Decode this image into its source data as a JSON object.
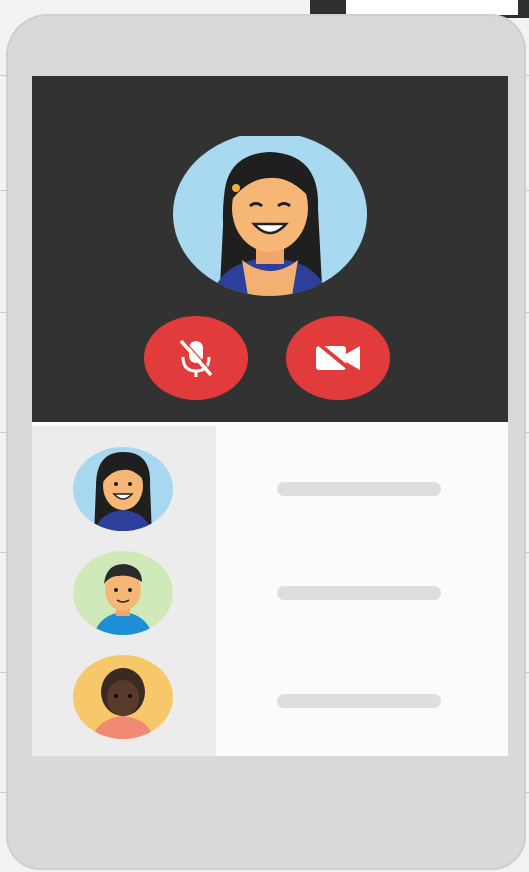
{
  "device": {
    "type": "smartphone"
  },
  "call": {
    "main_participant": {
      "avatar": "woman-avatar-icon"
    },
    "controls": [
      {
        "name": "mute-microphone-button",
        "icon": "mic-off-icon",
        "color": "#e23b3b"
      },
      {
        "name": "stop-video-button",
        "icon": "video-off-icon",
        "color": "#e23b3b"
      }
    ]
  },
  "participants": [
    {
      "avatar": "woman-avatar-icon",
      "avatar_bg": "#a8d8ef"
    },
    {
      "avatar": "man-avatar-icon",
      "avatar_bg": "#cfe9b9"
    },
    {
      "avatar": "person-dark-hair-avatar-icon",
      "avatar_bg": "#f7c86a"
    }
  ],
  "colors": {
    "video_background": "#323232",
    "control_red": "#e23b3b",
    "phone_frame": "#d9d9d9"
  }
}
